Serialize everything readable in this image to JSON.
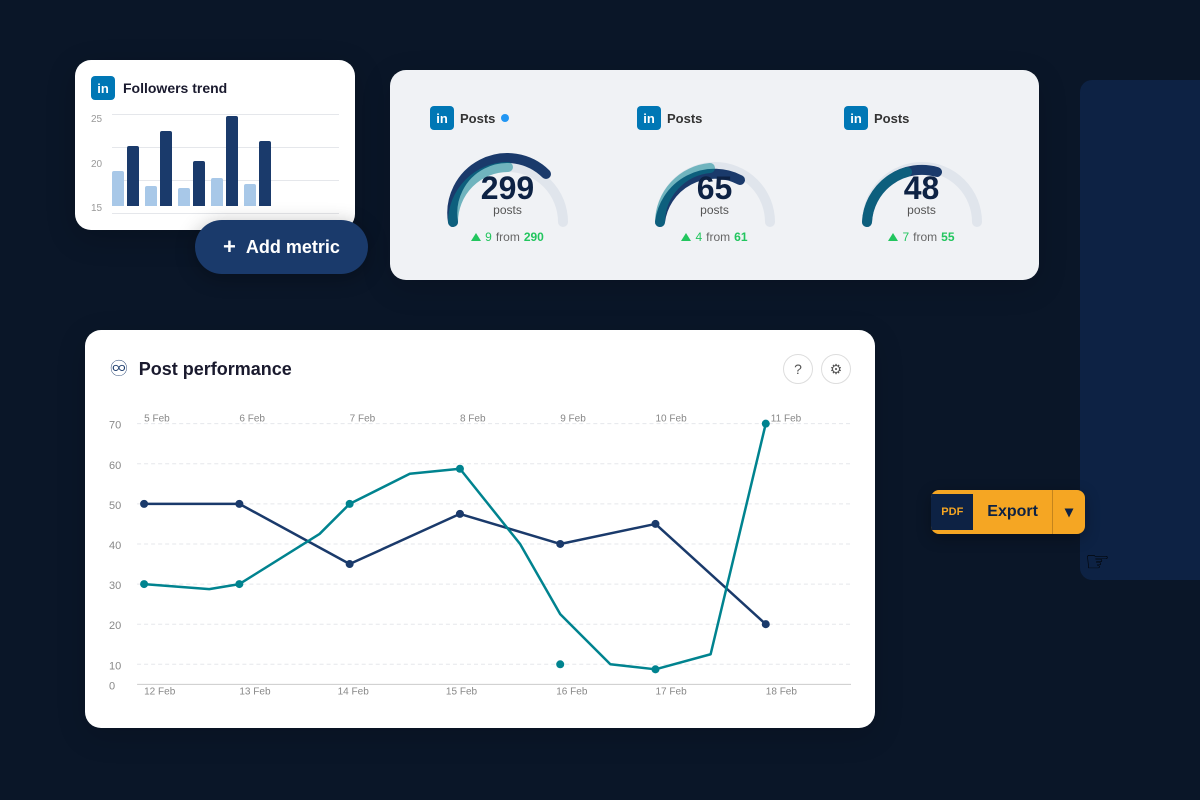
{
  "background": "#0a1628",
  "followers_card": {
    "title": "Followers trend",
    "y_labels": [
      "25",
      "20",
      "15"
    ],
    "bars": [
      {
        "light": 30,
        "dark": 55
      },
      {
        "light": 20,
        "dark": 70
      },
      {
        "light": 15,
        "dark": 40
      },
      {
        "light": 25,
        "dark": 85
      },
      {
        "light": 18,
        "dark": 60
      }
    ]
  },
  "add_metric": {
    "label": "Add metric",
    "plus": "+"
  },
  "post_cards": [
    {
      "id": "card1",
      "platform": "in",
      "title": "Posts",
      "has_dot": true,
      "dot_color": "#2196f3",
      "value": "299",
      "unit": "posts",
      "change": "9",
      "from": "from",
      "from_value": "290"
    },
    {
      "id": "card2",
      "platform": "in",
      "title": "Posts",
      "has_dot": false,
      "value": "65",
      "unit": "posts",
      "change": "4",
      "from": "from",
      "from_value": "61"
    },
    {
      "id": "card3",
      "platform": "in",
      "title": "Posts",
      "has_dot": false,
      "value": "48",
      "unit": "posts",
      "change": "7",
      "from": "from",
      "from_value": "55"
    }
  ],
  "performance": {
    "title": "Post performance",
    "help_btn": "?",
    "settings_btn": "⚙",
    "x_labels": [
      "5 Feb",
      "6 Feb",
      "7 Feb",
      "8 Feb",
      "9 Feb",
      "10 Feb",
      "11 Feb"
    ],
    "x_labels2": [
      "12 Feb",
      "13 Feb",
      "14 Feb",
      "15 Feb",
      "16 Feb",
      "17 Feb",
      "18 Feb"
    ],
    "y_labels": [
      "0",
      "10",
      "20",
      "30",
      "40",
      "50",
      "60",
      "70"
    ]
  },
  "export": {
    "pdf_label": "PDF",
    "label": "Export"
  },
  "colors": {
    "dark_navy": "#0d2244",
    "blue": "#1a3a6b",
    "teal": "#00838f",
    "light_blue": "#4fc3f7",
    "orange": "#f5a623",
    "green": "#22c55e"
  }
}
